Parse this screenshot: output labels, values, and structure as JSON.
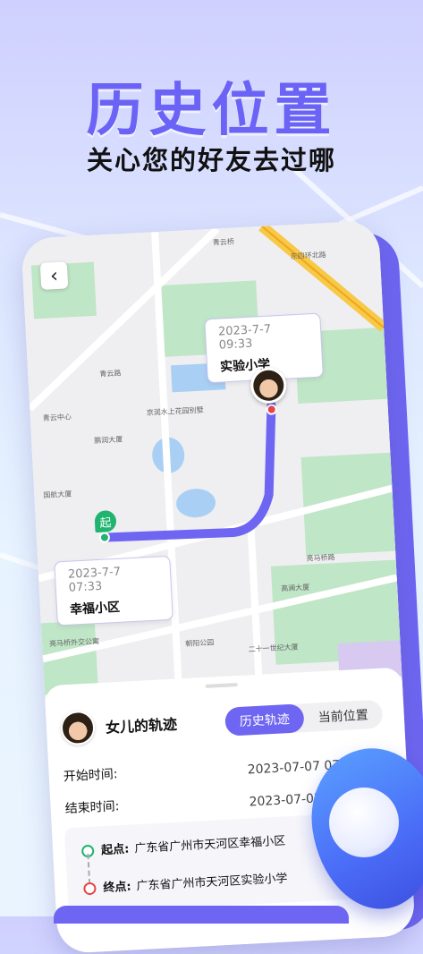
{
  "hero": {
    "title": "历史位置",
    "subtitle": "关心您的好友去过哪"
  },
  "map": {
    "back_icon": "chevron-left-icon",
    "end_bubble": {
      "time": "2023-7-7    09:33",
      "name": "实验小学"
    },
    "start_bubble": {
      "time": "2023-7-7    07:33",
      "name": "幸福小区"
    },
    "start_pin_label": "起",
    "labels": {
      "a": "青云桥",
      "b": "东四环北路",
      "c": "青云路",
      "d": "青云中心",
      "e": "京润水上花园别墅",
      "f": "鹏润大厦",
      "g": "国航大厦",
      "h": "亮马桥路",
      "i": "高澜大厦",
      "j": "亮马桥外交公寓",
      "k": "朝阳公园",
      "l": "二十一世纪大厦"
    },
    "colors": {
      "route": "#6e66f2",
      "start": "#1fb46f",
      "end": "#e54545"
    }
  },
  "sheet": {
    "user_name": "女儿的轨迹",
    "tabs": [
      {
        "label": "历史轨迹",
        "active": true
      },
      {
        "label": "当前位置",
        "active": false
      }
    ],
    "start_time_label": "开始时间:",
    "start_time_value": "2023-07-07 07:33",
    "end_time_label": "结束时间:",
    "end_time_value": "2023-07-07 09:33",
    "route": {
      "start_label": "起点:",
      "start_value": "广东省广州市天河区幸福小区",
      "end_label": "终点:",
      "end_value": "广东省广州市天河区实验小学"
    }
  }
}
